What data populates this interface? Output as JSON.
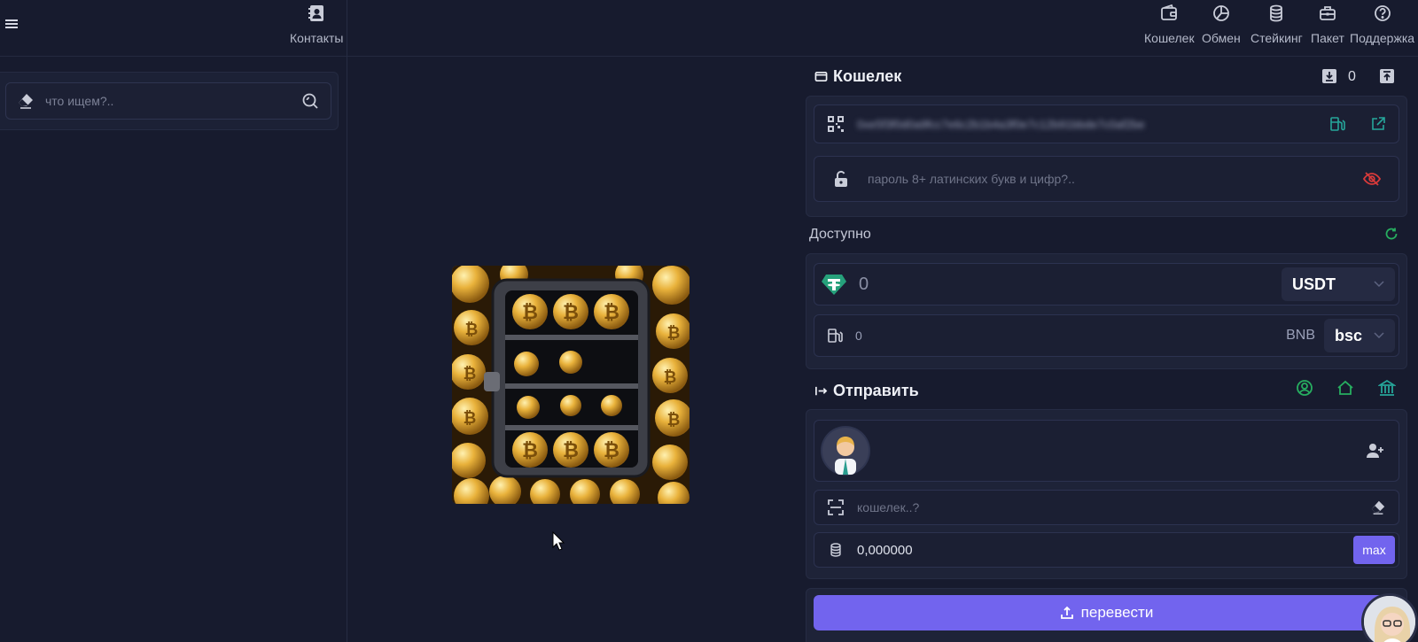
{
  "nav": {
    "contacts": "Контакты",
    "wallet": "Кошелек",
    "exchange": "Обмен",
    "staking": "Стейкинг",
    "package": "Пакет",
    "support": "Поддержка"
  },
  "search": {
    "placeholder": "что ищем?.."
  },
  "wallet": {
    "title": "Кошелек",
    "counter": "0",
    "address": "0xe5f3f0d0a9fcc7e6c2b1b4a3f0e7c12b91bbde7c0af2be",
    "password_placeholder": "пароль 8+ латинских букв и цифр?.."
  },
  "available": {
    "label": "Доступно",
    "amount": "0",
    "token": "USDT",
    "gas_amount": "0",
    "gas_token": "BNB",
    "network": "bsc"
  },
  "send": {
    "title": "Отправить",
    "wallet_placeholder": "кошелек..?",
    "amount": "0,000000",
    "max_label": "max",
    "submit_label": "перевести"
  },
  "colors": {
    "background": "#171b2e",
    "accent": "#7264ee",
    "green": "#27ae60",
    "teal": "#26a69a",
    "red": "#d83a3a"
  },
  "icons": [
    "menu-icon",
    "contacts-icon",
    "wallet-icon",
    "exchange-icon",
    "staking-icon",
    "package-icon",
    "support-icon",
    "eraser-icon",
    "search-icon",
    "download-icon",
    "upload-icon",
    "qr-icon",
    "fuel-icon",
    "external-link-icon",
    "unlock-icon",
    "eye-off-icon",
    "refresh-icon",
    "tether-icon",
    "chevron-down-icon",
    "send-arrow-icon",
    "user-circle-icon",
    "home-icon",
    "bank-icon",
    "user-plus-icon",
    "scan-icon",
    "coins-icon",
    "upload-tray-icon"
  ]
}
